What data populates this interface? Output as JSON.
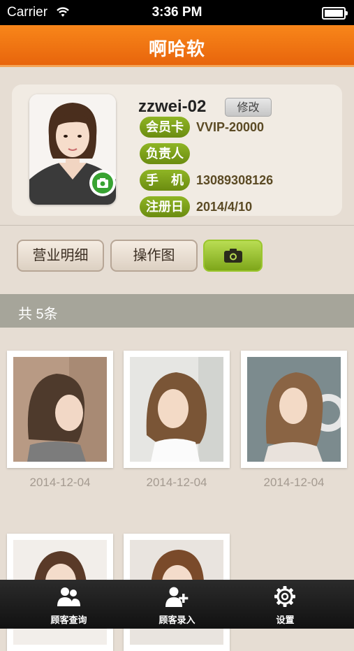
{
  "status": {
    "carrier": "Carrier",
    "time": "3:36 PM"
  },
  "navbar": {
    "title": "啊哈软"
  },
  "profile": {
    "username": "zzwei-02",
    "edit_label": "修改",
    "rows": [
      {
        "label": "会员卡",
        "value": "VVIP-20000"
      },
      {
        "label": "负责人",
        "value": ""
      },
      {
        "label": "手　机",
        "value": "13089308126"
      },
      {
        "label": "注册日",
        "value": "2014/4/10"
      }
    ]
  },
  "tabs": {
    "details": "营业明细",
    "operations": "操作图",
    "camera_icon": "camera-icon"
  },
  "list": {
    "count_text": "共 5条",
    "photos": [
      {
        "date": "2014-12-04"
      },
      {
        "date": "2014-12-04"
      },
      {
        "date": "2014-12-04"
      },
      {
        "date": ""
      },
      {
        "date": ""
      }
    ]
  },
  "tabbar": {
    "items": [
      {
        "label": "顾客查询",
        "icon": "customers-icon"
      },
      {
        "label": "顾客录入",
        "icon": "add-customer-icon"
      },
      {
        "label": "设置",
        "icon": "gear-icon"
      }
    ]
  },
  "colors": {
    "accent": "#f07812",
    "green": "#7ea61a"
  }
}
